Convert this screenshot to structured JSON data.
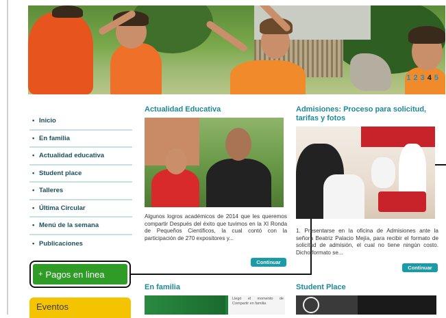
{
  "hero": {
    "pager": [
      "1",
      "2",
      "3",
      "4",
      "5"
    ],
    "active_page": "4"
  },
  "nav": {
    "bullet": "•",
    "items": [
      {
        "label": "Inicio"
      },
      {
        "label": "En familia"
      },
      {
        "label": "Actualidad educativa"
      },
      {
        "label": "Student place"
      },
      {
        "label": "Talleres"
      },
      {
        "label": "Última Circular"
      },
      {
        "label": "Menú de la semana"
      },
      {
        "label": "Publicaciones"
      }
    ]
  },
  "pagos": {
    "label": "Pagos en linea",
    "plus": "+"
  },
  "eventos": {
    "label": "Eventos"
  },
  "articles": {
    "actualidad": {
      "title": "Actualidad Educativa",
      "text": "Algunos logros académicos de 2014 que les queremos compartir  Después del éxito que tuvimos en la XI Ronda de Pequeños Científicos, la cual contó con la participación de 270 expositores y...",
      "button": "Continuar"
    },
    "admisiones": {
      "title": "Admisiones: Proceso para solicitud, tarifas y fotos",
      "text": "1. Presentarse en la oficina de Admisiones ante la señora Beatriz Palacio Mejía, para recibir el formato de solicitud de admisión, el cual no tiene ningún costo. Dicho formato se...",
      "button": "Continuar"
    },
    "familia": {
      "title": "En familia",
      "thumb_caption": "Llegó el momento de Compartir en familia"
    },
    "student": {
      "title": "Student Place"
    }
  },
  "colors": {
    "accent": "#1b8a9a",
    "button": "#1b9aa8",
    "nav_text": "#1a4f60",
    "pagos_green": "#2f9c28",
    "eventos_yellow": "#f5c400"
  }
}
